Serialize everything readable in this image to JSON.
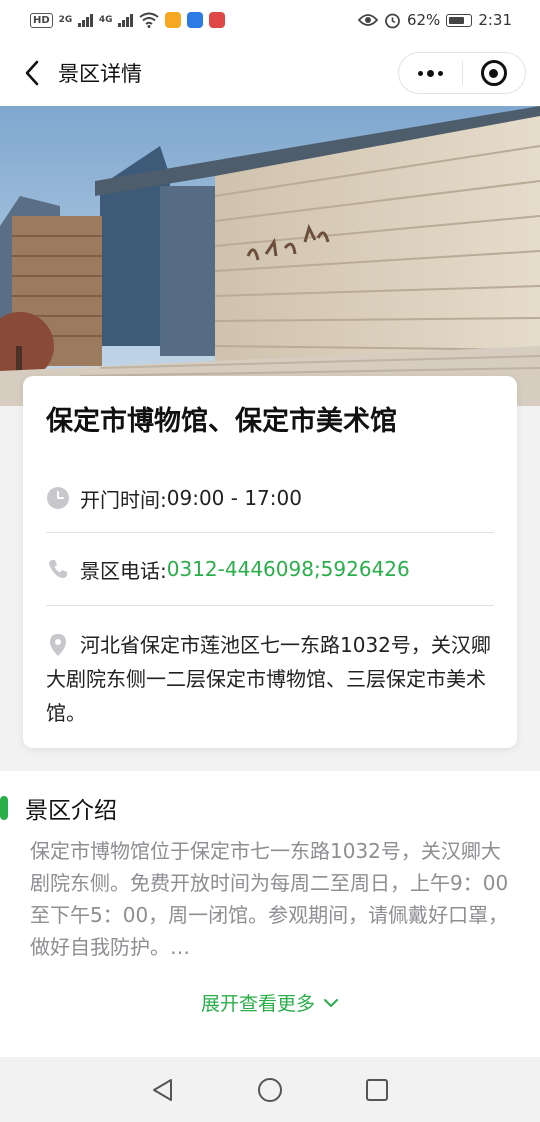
{
  "status_bar": {
    "hd_badge": "HD",
    "net1": "2G",
    "net2": "4G",
    "battery": "62%",
    "time": "2:31"
  },
  "nav": {
    "title": "景区详情",
    "back_icon": "chevron-left-icon",
    "more_icon": "more-dots-icon",
    "close_icon": "target-icon"
  },
  "poi": {
    "title": "保定市博物馆、保定市美术馆",
    "hours_label": "开门时间: ",
    "hours_value": "09:00 - 17:00",
    "phone_label": "景区电话: ",
    "phone_value": "0312-4446098;5926426",
    "address": "河北省保定市莲池区七一东路1032号，关汉卿大剧院东侧一二层保定市博物馆、三层保定市美术馆。"
  },
  "intro": {
    "title": "景区介绍",
    "text": "保定市博物馆位于保定市七一东路1032号，关汉卿大剧院东侧。免费开放时间为每周二至周日，上午9：00至下午5：00，周一闭馆。参观期间，请佩戴好口罩，做好自我防护。…",
    "expand_label": "展开查看更多"
  },
  "colors": {
    "accent": "#2aae4a",
    "muted_text": "#8e8e93"
  }
}
